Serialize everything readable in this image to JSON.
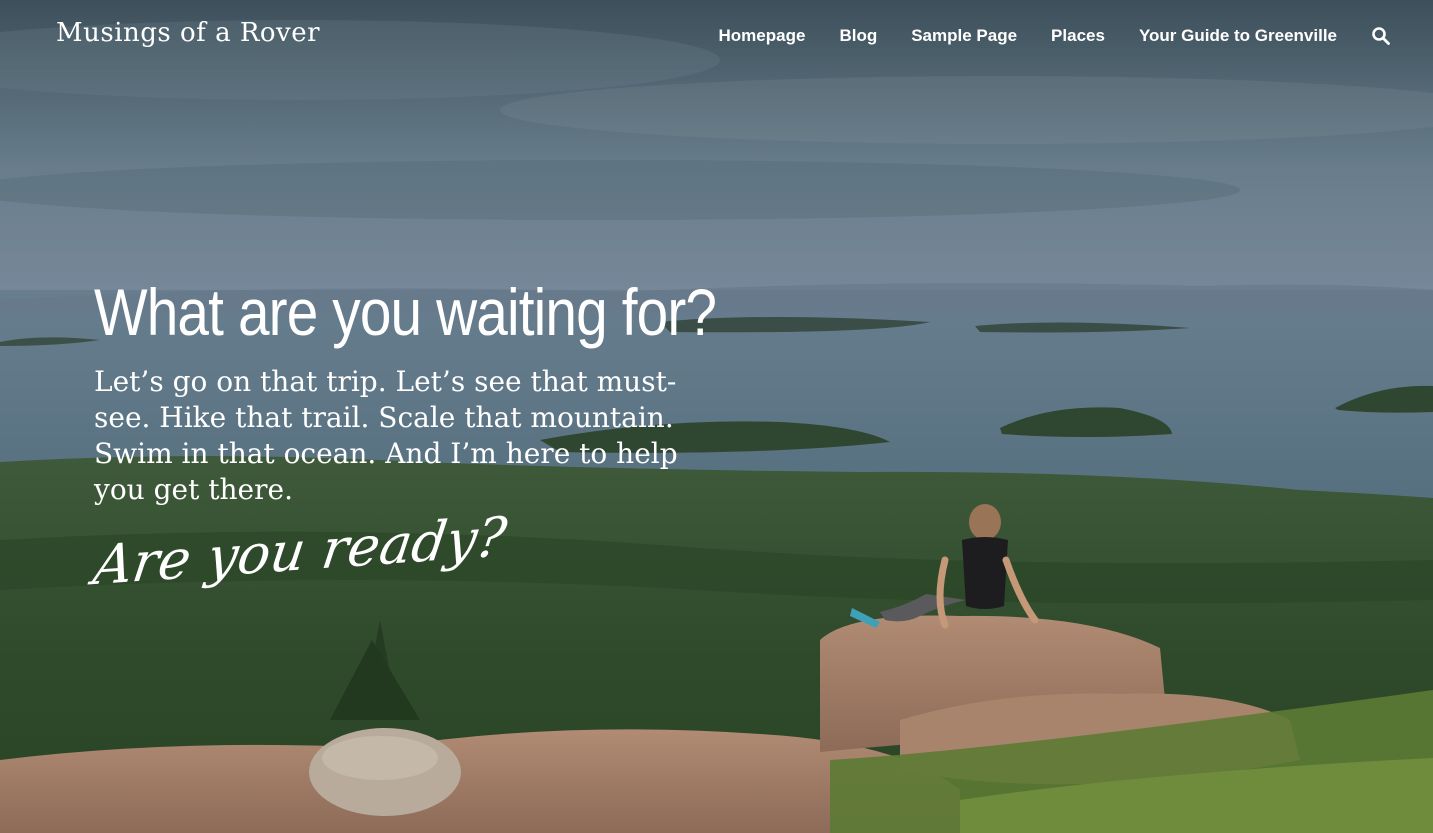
{
  "site": {
    "title": "Musings of a Rover"
  },
  "nav": {
    "items": [
      {
        "label": "Homepage"
      },
      {
        "label": "Blog"
      },
      {
        "label": "Sample Page"
      },
      {
        "label": "Places"
      },
      {
        "label": "Your Guide to Greenville"
      }
    ],
    "search_icon": "search-icon"
  },
  "hero": {
    "headline": "What are you waiting for?",
    "body": "Let’s go on that trip. Let’s see that must-see. Hike that trail. Scale that mountain. Swim in that ocean. And I’m here to help you get there.",
    "cta": "Are you ready?",
    "background": "coastal-mountain-vista-photo"
  },
  "colors": {
    "text": "#ffffff",
    "sky_top": "#4b6270",
    "sea": "#5f7686",
    "forest": "#2f4a2a",
    "granite": "#a9826c"
  }
}
